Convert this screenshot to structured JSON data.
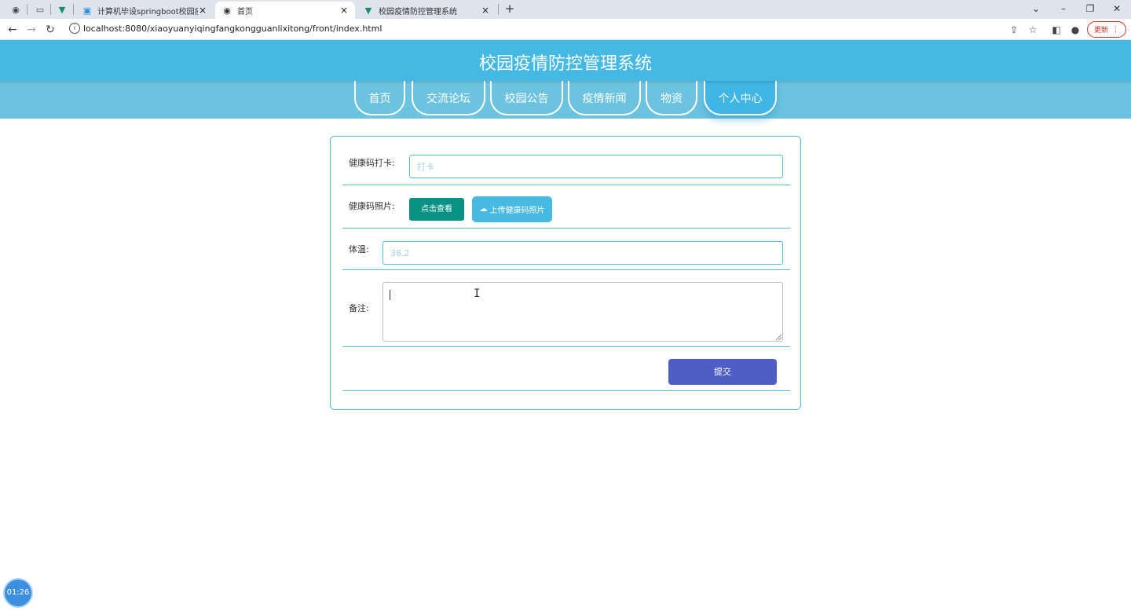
{
  "browser": {
    "tabs": [
      {
        "title": "计算机毕设springboot校园疫情",
        "close": "×"
      },
      {
        "title": "首页",
        "close": "×"
      },
      {
        "title": "校园疫情防控管理系统",
        "close": "×"
      }
    ],
    "new_tab": "+",
    "url": "localhost:8080/xiaoyuanyiqingfangkongguanlixitong/front/index.html",
    "update_label": "更新"
  },
  "site": {
    "title": "校园疫情防控管理系统",
    "nav": [
      "首页",
      "交流论坛",
      "校园公告",
      "疫情新闻",
      "物资",
      "个人中心"
    ],
    "active_nav": "个人中心"
  },
  "form": {
    "checkin_label": "健康码打卡:",
    "checkin_placeholder": "打卡",
    "photo_label": "健康码照片:",
    "view_button": "点击查看",
    "upload_button": "上传健康码照片",
    "temp_label": "体温:",
    "temp_value": "38.2",
    "remark_label": "备注:",
    "remark_value": "",
    "submit_button": "提交"
  },
  "timer": "01:26"
}
